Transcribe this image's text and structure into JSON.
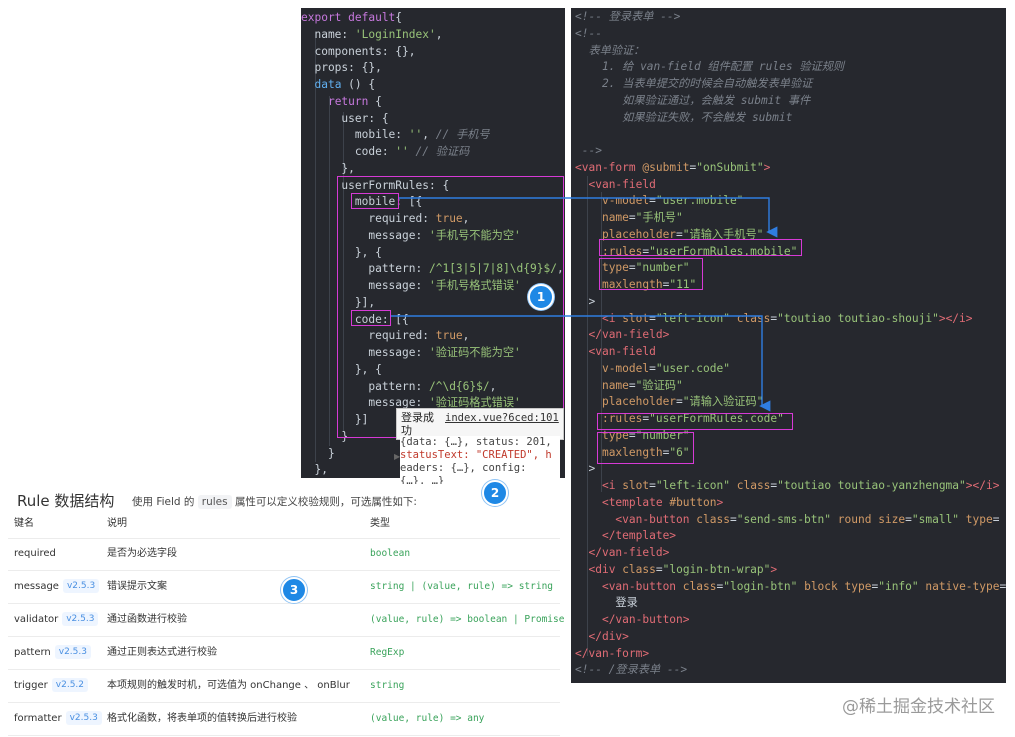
{
  "left_code": [
    [
      [
        "kw",
        "export default"
      ],
      [
        "",
        "{"
      ]
    ],
    [
      [
        "",
        "  name: "
      ],
      [
        "str",
        "'LoginIndex'"
      ],
      [
        "",
        ","
      ]
    ],
    [
      [
        "",
        "  components: {},"
      ]
    ],
    [
      [
        "",
        "  props: {},"
      ]
    ],
    [
      [
        "",
        "  "
      ],
      [
        "blue",
        "data"
      ],
      [
        "",
        " () {"
      ]
    ],
    [
      [
        "",
        "    "
      ],
      [
        "kw",
        "return"
      ],
      [
        "",
        " {"
      ]
    ],
    [
      [
        "",
        "      user: {"
      ]
    ],
    [
      [
        "",
        "        mobile: "
      ],
      [
        "str",
        "''"
      ],
      [
        "",
        ", "
      ],
      [
        "cm",
        "// 手机号"
      ]
    ],
    [
      [
        "",
        "        code: "
      ],
      [
        "str",
        "''"
      ],
      [
        "cm",
        " // 验证码"
      ]
    ],
    [
      [
        "",
        "      },"
      ]
    ],
    [
      [
        "",
        "      userFormRules: {"
      ]
    ],
    [
      [
        "",
        "        mobile: [{"
      ]
    ],
    [
      [
        "",
        "          required: "
      ],
      [
        "num",
        "true"
      ],
      [
        "",
        ","
      ]
    ],
    [
      [
        "",
        "          message: "
      ],
      [
        "str",
        "'手机号不能为空'"
      ]
    ],
    [
      [
        "",
        "        }, {"
      ]
    ],
    [
      [
        "",
        "          pattern: "
      ],
      [
        "str",
        "/^1[3|5|7|8]\\d{9}$/"
      ],
      [
        "",
        ","
      ]
    ],
    [
      [
        "",
        "          message: "
      ],
      [
        "str",
        "'手机号格式错误'"
      ]
    ],
    [
      [
        "",
        "        }],"
      ]
    ],
    [
      [
        "",
        "        code: [{"
      ]
    ],
    [
      [
        "",
        "          required: "
      ],
      [
        "num",
        "true"
      ],
      [
        "",
        ","
      ]
    ],
    [
      [
        "",
        "          message: "
      ],
      [
        "str",
        "'验证码不能为空'"
      ]
    ],
    [
      [
        "",
        "        }, {"
      ]
    ],
    [
      [
        "",
        "          pattern: "
      ],
      [
        "str",
        "/^\\d{6}$/"
      ],
      [
        "",
        ","
      ]
    ],
    [
      [
        "",
        "          message: "
      ],
      [
        "str",
        "'验证码格式错误'"
      ]
    ],
    [
      [
        "",
        "        }]"
      ]
    ],
    [
      [
        "",
        "      }"
      ]
    ],
    [
      [
        "",
        "    }"
      ]
    ],
    [
      [
        "",
        "  },"
      ]
    ]
  ],
  "right_code": [
    [
      [
        "cm",
        "<!-- 登录表单 -->"
      ]
    ],
    [
      [
        "cm",
        "<!--"
      ]
    ],
    [
      [
        "cm",
        "  表单验证："
      ]
    ],
    [
      [
        "cm",
        "    1. 给 van-field 组件配置 rules 验证规则"
      ]
    ],
    [
      [
        "cm",
        "    2. 当表单提交的时候会自动触发表单验证"
      ]
    ],
    [
      [
        "cm",
        "       如果验证通过，会触发 submit 事件"
      ]
    ],
    [
      [
        "cm",
        "       如果验证失败，不会触发 submit"
      ]
    ],
    [
      [
        "cm",
        ""
      ]
    ],
    [
      [
        "cm",
        " -->"
      ]
    ],
    [
      [
        "tag",
        "<van-form"
      ],
      [
        "",
        " "
      ],
      [
        "attr",
        "@submit"
      ],
      [
        "",
        "="
      ],
      [
        "str",
        "\"onSubmit\""
      ],
      [
        "tag",
        ">"
      ]
    ],
    [
      [
        "",
        "  "
      ],
      [
        "tag",
        "<van-field"
      ]
    ],
    [
      [
        "",
        "    "
      ],
      [
        "attr",
        "v-model"
      ],
      [
        "",
        "="
      ],
      [
        "str",
        "\"user.mobile\""
      ]
    ],
    [
      [
        "",
        "    "
      ],
      [
        "attr",
        "name"
      ],
      [
        "",
        "="
      ],
      [
        "str",
        "\"手机号\""
      ]
    ],
    [
      [
        "",
        "    "
      ],
      [
        "attr",
        "placeholder"
      ],
      [
        "",
        "="
      ],
      [
        "str",
        "\"请输入手机号\""
      ]
    ],
    [
      [
        "",
        "    "
      ],
      [
        "attr",
        ":rules"
      ],
      [
        "",
        "="
      ],
      [
        "str",
        "\"userFormRules.mobile\""
      ]
    ],
    [
      [
        "",
        "    "
      ],
      [
        "attr",
        "type"
      ],
      [
        "",
        "="
      ],
      [
        "str",
        "\"number\""
      ]
    ],
    [
      [
        "",
        "    "
      ],
      [
        "attr",
        "maxlength"
      ],
      [
        "",
        "="
      ],
      [
        "str",
        "\"11\""
      ]
    ],
    [
      [
        "",
        "  >"
      ]
    ],
    [
      [
        "",
        "    "
      ],
      [
        "tag",
        "<i"
      ],
      [
        "",
        " "
      ],
      [
        "attr",
        "slot"
      ],
      [
        "",
        "="
      ],
      [
        "str",
        "\"left-icon\""
      ],
      [
        "",
        " "
      ],
      [
        "attr",
        "class"
      ],
      [
        "",
        "="
      ],
      [
        "str",
        "\"toutiao toutiao-shouji\""
      ],
      [
        "tag",
        "></i>"
      ]
    ],
    [
      [
        "",
        "  "
      ],
      [
        "tag",
        "</van-field>"
      ]
    ],
    [
      [
        "",
        "  "
      ],
      [
        "tag",
        "<van-field"
      ]
    ],
    [
      [
        "",
        "    "
      ],
      [
        "attr",
        "v-model"
      ],
      [
        "",
        "="
      ],
      [
        "str",
        "\"user.code\""
      ]
    ],
    [
      [
        "",
        "    "
      ],
      [
        "attr",
        "name"
      ],
      [
        "",
        "="
      ],
      [
        "str",
        "\"验证码\""
      ]
    ],
    [
      [
        "",
        "    "
      ],
      [
        "attr",
        "placeholder"
      ],
      [
        "",
        "="
      ],
      [
        "str",
        "\"请输入验证码\""
      ]
    ],
    [
      [
        "",
        "    "
      ],
      [
        "attr",
        ":rules"
      ],
      [
        "",
        "="
      ],
      [
        "str",
        "\"userFormRules.code\""
      ]
    ],
    [
      [
        "",
        "    "
      ],
      [
        "attr",
        "type"
      ],
      [
        "",
        "="
      ],
      [
        "str",
        "\"number\""
      ]
    ],
    [
      [
        "",
        "    "
      ],
      [
        "attr",
        "maxlength"
      ],
      [
        "",
        "="
      ],
      [
        "str",
        "\"6\""
      ]
    ],
    [
      [
        "",
        "  >"
      ]
    ],
    [
      [
        "",
        "    "
      ],
      [
        "tag",
        "<i"
      ],
      [
        "",
        " "
      ],
      [
        "attr",
        "slot"
      ],
      [
        "",
        "="
      ],
      [
        "str",
        "\"left-icon\""
      ],
      [
        "",
        " "
      ],
      [
        "attr",
        "class"
      ],
      [
        "",
        "="
      ],
      [
        "str",
        "\"toutiao toutiao-yanzhengma\""
      ],
      [
        "tag",
        "></i>"
      ]
    ],
    [
      [
        "",
        "    "
      ],
      [
        "tag",
        "<template"
      ],
      [
        "",
        " "
      ],
      [
        "attr",
        "#button"
      ],
      [
        "tag",
        ">"
      ]
    ],
    [
      [
        "",
        "      "
      ],
      [
        "tag",
        "<van-button"
      ],
      [
        "",
        " "
      ],
      [
        "attr",
        "class"
      ],
      [
        "",
        "="
      ],
      [
        "str",
        "\"send-sms-btn\""
      ],
      [
        "",
        " "
      ],
      [
        "attr",
        "round"
      ],
      [
        "",
        " "
      ],
      [
        "attr",
        "size"
      ],
      [
        "",
        "="
      ],
      [
        "str",
        "\"small\""
      ],
      [
        "",
        " "
      ],
      [
        "attr",
        "type"
      ],
      [
        "",
        "="
      ]
    ],
    [
      [
        "",
        "    "
      ],
      [
        "tag",
        "</template>"
      ]
    ],
    [
      [
        "",
        "  "
      ],
      [
        "tag",
        "</van-field>"
      ]
    ],
    [
      [
        "",
        "  "
      ],
      [
        "tag",
        "<div"
      ],
      [
        "",
        " "
      ],
      [
        "attr",
        "class"
      ],
      [
        "",
        "="
      ],
      [
        "str",
        "\"login-btn-wrap\""
      ],
      [
        "tag",
        ">"
      ]
    ],
    [
      [
        "",
        "    "
      ],
      [
        "tag",
        "<van-button"
      ],
      [
        "",
        " "
      ],
      [
        "attr",
        "class"
      ],
      [
        "",
        "="
      ],
      [
        "str",
        "\"login-btn\""
      ],
      [
        "",
        " "
      ],
      [
        "attr",
        "block"
      ],
      [
        "",
        " "
      ],
      [
        "attr",
        "type"
      ],
      [
        "",
        "="
      ],
      [
        "str",
        "\"info\""
      ],
      [
        "",
        " "
      ],
      [
        "attr",
        "native-type"
      ],
      [
        "",
        "="
      ]
    ],
    [
      [
        "",
        "      登录"
      ]
    ],
    [
      [
        "",
        "    "
      ],
      [
        "tag",
        "</van-button>"
      ]
    ],
    [
      [
        "",
        "  "
      ],
      [
        "tag",
        "</div>"
      ]
    ],
    [
      [
        "tag",
        "</van-form>"
      ]
    ],
    [
      [
        "cm",
        "<!-- /登录表单 -->"
      ]
    ]
  ],
  "debug": {
    "toast_text": "登录成功",
    "source_link": "index.vue?6ced:101",
    "response_lines": [
      "{data: {…}, status: 201,",
      "statusText: \"CREATED\", h",
      "eaders: {…}, config:",
      "{…}, …}"
    ]
  },
  "badges": [
    "1",
    "2",
    "3"
  ],
  "doc": {
    "title": "Rule 数据结构",
    "subtitle_pre": "使用 Field 的",
    "subtitle_code": "rules",
    "subtitle_post": "属性可以定义校验规则，可选属性如下:",
    "headers": [
      "键名",
      "说明",
      "类型"
    ],
    "rows": [
      {
        "key": "required",
        "version": "",
        "desc": "是否为必选字段",
        "type": "boolean"
      },
      {
        "key": "message",
        "version": "v2.5.3",
        "desc": "错误提示文案",
        "type": "string | (value, rule) => string"
      },
      {
        "key": "validator",
        "version": "v2.5.3",
        "desc": "通过函数进行校验",
        "type": "(value, rule) => boolean | Promise"
      },
      {
        "key": "pattern",
        "version": "v2.5.3",
        "desc": "通过正则表达式进行校验",
        "type": "RegExp"
      },
      {
        "key": "trigger",
        "version": "v2.5.2",
        "desc": "本项规则的触发时机，可选值为 onChange 、 onBlur",
        "type": "string"
      },
      {
        "key": "formatter",
        "version": "v2.5.3",
        "desc": "格式化函数，将表单项的值转换后进行校验",
        "type": "(value, rule) => any"
      }
    ]
  },
  "watermark": "@稀土掘金技术社区",
  "colors": {
    "editor_bg": "#26282e",
    "highlight_box": "#d63ad6",
    "arrow": "#2f7de1",
    "badge": "#1e88e5"
  }
}
